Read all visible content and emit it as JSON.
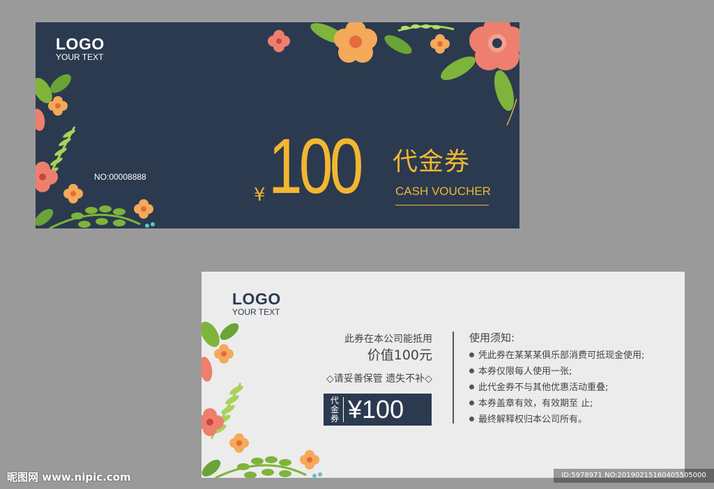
{
  "front": {
    "logo": "LOGO",
    "logo_sub": "YOUR TEXT",
    "serial": "NO:00008888",
    "currency": "¥",
    "amount": "100",
    "title_cn": "代金券",
    "title_en": "CASH VOUCHER"
  },
  "back": {
    "logo": "LOGO",
    "logo_sub": "YOUR TEXT",
    "usage": "此券在本公司能抵用",
    "value": "价值100元",
    "keep": "◇请妥善保管 遗失不补◇",
    "tag_chars": [
      "代",
      "金",
      "券"
    ],
    "price": "¥100",
    "rules_title": "使用须知:",
    "rules": [
      "凭此券在某某某俱乐部消费可抵现金使用;",
      "本券仅限每人使用一张;",
      "此代金券不与其他优惠活动重叠;",
      "本券盖章有效，有效期至          止;",
      "最终解释权归本公司所有。"
    ]
  },
  "watermark": {
    "left": "昵图网 www.nipic.com",
    "right": "ID:5978971 NO:20190215160405505000"
  },
  "colors": {
    "page_bg": "#9a9a9a",
    "front_bg": "#2b3a4f",
    "back_bg": "#ececec",
    "gold": "#f2b631",
    "flower_orange": "#f4a95b",
    "flower_pink": "#ee7f6e",
    "leaf_green": "#7fb43b"
  },
  "icons": [
    "flower-decoration-icon",
    "leaf-decoration-icon",
    "bullet-dot-icon"
  ]
}
